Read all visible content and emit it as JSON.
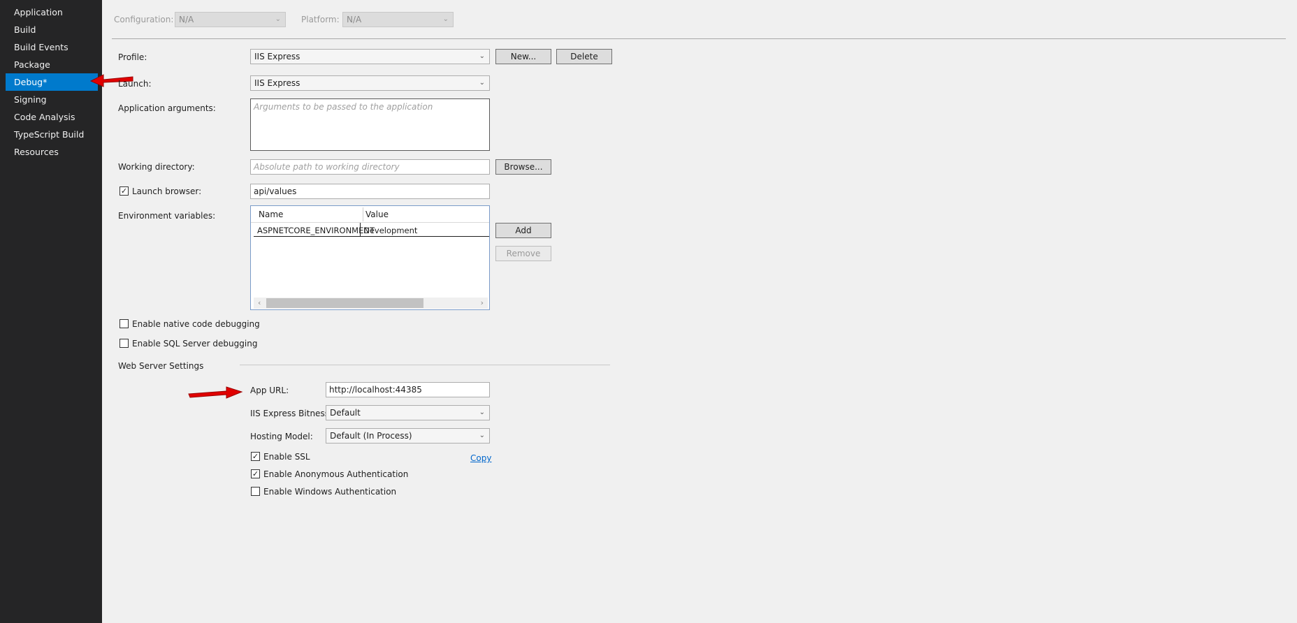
{
  "sidebar": {
    "items": [
      {
        "label": "Application"
      },
      {
        "label": "Build"
      },
      {
        "label": "Build Events"
      },
      {
        "label": "Package"
      },
      {
        "label": "Debug*"
      },
      {
        "label": "Signing"
      },
      {
        "label": "Code Analysis"
      },
      {
        "label": "TypeScript Build"
      },
      {
        "label": "Resources"
      }
    ],
    "active_index": 4
  },
  "top": {
    "configuration_label": "Configuration:",
    "configuration_value": "N/A",
    "platform_label": "Platform:",
    "platform_value": "N/A"
  },
  "profile": {
    "label": "Profile:",
    "value": "IIS Express",
    "new_button": "New...",
    "delete_button": "Delete"
  },
  "launch": {
    "label": "Launch:",
    "value": "IIS Express"
  },
  "app_args": {
    "label": "Application arguments:",
    "placeholder": "Arguments to be passed to the application"
  },
  "working_dir": {
    "label": "Working directory:",
    "placeholder": "Absolute path to working directory",
    "browse_button": "Browse..."
  },
  "launch_browser": {
    "label": "Launch browser:",
    "checked": true,
    "value": "api/values"
  },
  "env_vars": {
    "label": "Environment variables:",
    "columns": [
      "Name",
      "Value"
    ],
    "rows": [
      {
        "name": "ASPNETCORE_ENVIRONMENT",
        "value": "Development"
      }
    ],
    "add_button": "Add",
    "remove_button": "Remove"
  },
  "options": {
    "native_debugging": "Enable native code debugging",
    "sql_debugging": "Enable SQL Server debugging"
  },
  "web_server": {
    "section_label": "Web Server Settings",
    "app_url_label": "App URL:",
    "app_url_value": "http://localhost:44385",
    "bitness_label": "IIS Express Bitness:",
    "bitness_value": "Default",
    "hosting_label": "Hosting Model:",
    "hosting_value": "Default (In Process)",
    "ssl_label": "Enable SSL",
    "ssl_checked": true,
    "copy_link": "Copy",
    "anon_auth_label": "Enable Anonymous Authentication",
    "anon_auth_checked": true,
    "windows_auth_label": "Enable Windows Authentication",
    "windows_auth_checked": false
  },
  "colors": {
    "sidebar_bg": "#252526",
    "active_item_bg": "#007acc",
    "annotation_arrow": "#e00000",
    "link": "#0066cc"
  }
}
